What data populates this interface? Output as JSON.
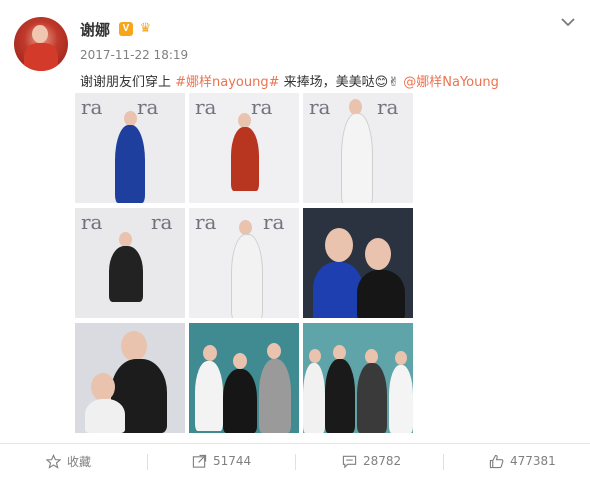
{
  "post": {
    "username": "谢娜",
    "vip_badge": "V",
    "timestamp": "2017-11-22 18:19",
    "text_before": "谢谢朋友们穿上 ",
    "hashtag": "#娜样nayoung#",
    "text_middle": " 来捧场，美美哒",
    "emoji_smile": "😊",
    "emoji_victory": "✌",
    "mention": "@娜样NaYoung"
  },
  "photos": [
    {
      "label": "ra",
      "bg": "#ecebee",
      "outfit": "#1f3f9e"
    },
    {
      "label": "ra",
      "bg": "#f0eff2",
      "outfit": "#b8361f"
    },
    {
      "label": "ra",
      "bg": "#eeedf0",
      "outfit": "#f4f4f4"
    },
    {
      "label": "ra",
      "bg": "#e9e8eb",
      "outfit": "#222222"
    },
    {
      "label": "ra",
      "bg": "#efeef1",
      "outfit": "#f2f2f2"
    },
    {
      "label": "",
      "bg": "#2b3240",
      "outfit": "#1d3fb0"
    },
    {
      "label": "",
      "bg": "#d9dbe0",
      "outfit": "#1c1c1c"
    },
    {
      "label": "",
      "bg": "#3f8b91",
      "outfit": "#161616"
    },
    {
      "label": "",
      "bg": "#5ea4a9",
      "outfit": "#1a1a1a"
    }
  ],
  "actions": {
    "favorite": "收藏",
    "repost": "51744",
    "comment": "28782",
    "like": "477381"
  },
  "colors": {
    "link": "#eb7350",
    "text": "#333333",
    "muted": "#808080",
    "badge": "#f7a61c"
  }
}
